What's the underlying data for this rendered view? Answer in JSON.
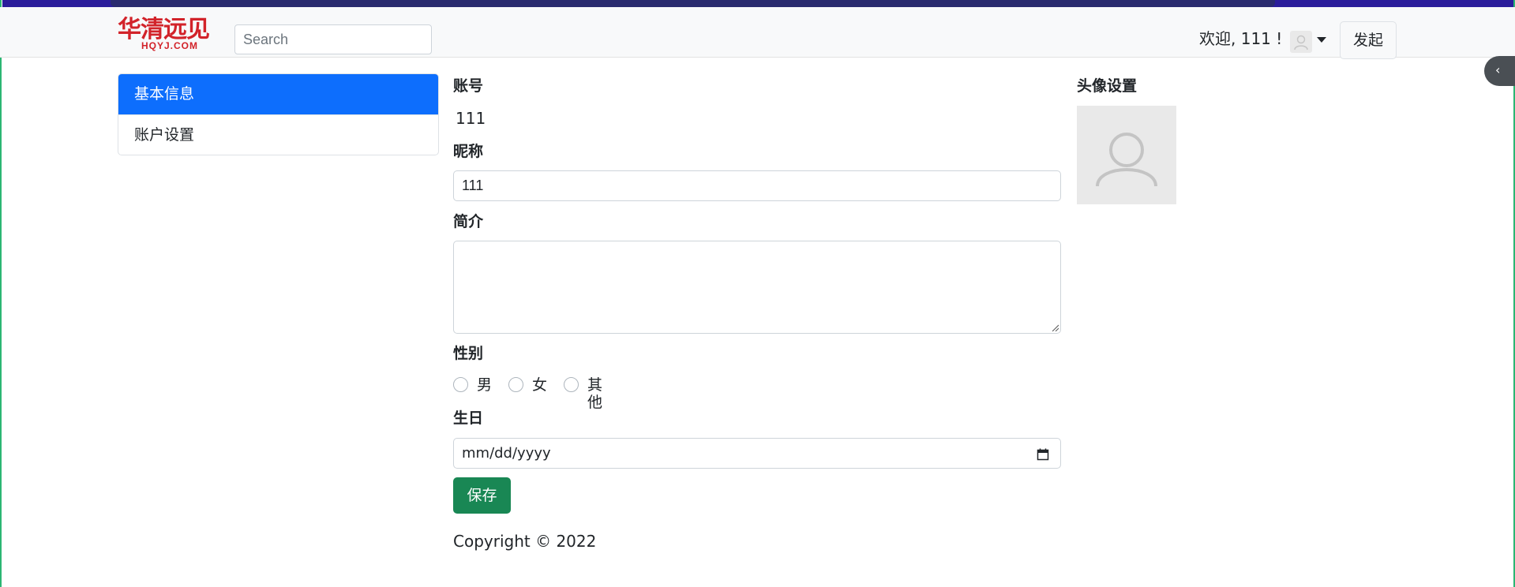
{
  "brand": {
    "logo_text": "华清远见",
    "logo_subtext": "HQYJ.COM"
  },
  "navbar": {
    "search_placeholder": "Search",
    "welcome": "欢迎, 111 !",
    "publish_label": "发起"
  },
  "sidebar": {
    "items": [
      {
        "label": "基本信息",
        "active": true
      },
      {
        "label": "账户设置",
        "active": false
      }
    ]
  },
  "form": {
    "account_label": "账号",
    "account_value": "111",
    "nickname_label": "昵称",
    "nickname_value": "111",
    "bio_label": "简介",
    "bio_value": "",
    "gender_label": "性别",
    "gender_options": [
      "男",
      "女",
      "其他"
    ],
    "birthday_label": "生日",
    "birthday_placeholder": "mm/dd/yyyy",
    "save_label": "保存"
  },
  "avatar_section": {
    "title": "头像设置"
  },
  "footer": {
    "copyright": "Copyright © 2022"
  },
  "colors": {
    "primary": "#0d6efd",
    "success": "#198754",
    "brand_red": "#d2232a"
  }
}
